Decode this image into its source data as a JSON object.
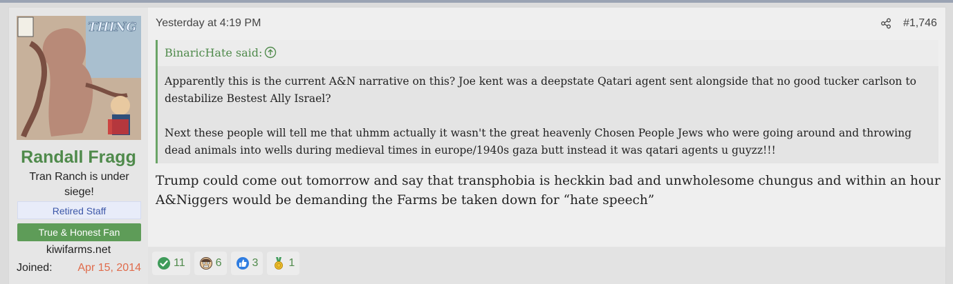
{
  "post": {
    "author": {
      "username": "Randall Fragg",
      "user_title": "Tran Ranch is under siege!",
      "banners": [
        "Retired Staff",
        "True & Honest Fan"
      ],
      "site": "kiwifarms.net",
      "joined_label": "Joined:",
      "joined_value": "Apr 15, 2014",
      "avatar_text": "THING OF THE HILL"
    },
    "timestamp": "Yesterday at 4:19 PM",
    "post_number": "#1,746",
    "quote": {
      "author": "BinaricHate said:",
      "paragraphs": [
        "Apparently this is the current A&N narrative on this? Joe kent was a deepstate Qatari agent sent alongside that no good tucker carlson to destabilize Bestest Ally Israel?",
        "Next these people will tell me that uhmm actually it wasn't the great heavenly Chosen People Jews who were going around and throwing dead animals into wells during medieval times in europe/1940s gaza butt instead it was qatari agents u guyzz!!!"
      ]
    },
    "message": "Trump could come out tomorrow and say that transphobia is heckkin bad and unwholesome chungus and within an hour A&Niggers would be demanding the Farms be taken down for “hate speech”",
    "reactions": [
      {
        "icon": "checkmark-icon",
        "count": "11"
      },
      {
        "icon": "face-icon",
        "count": "6"
      },
      {
        "icon": "thumbs-up-icon",
        "count": "3"
      },
      {
        "icon": "medal-icon",
        "count": "1"
      }
    ]
  },
  "colors": {
    "username": "#4f8a4b",
    "joined_date": "#e06b4b",
    "quote_bar": "#6aa466",
    "fan_banner": "#5e9c58",
    "staff_banner_text": "#3c57a8"
  }
}
